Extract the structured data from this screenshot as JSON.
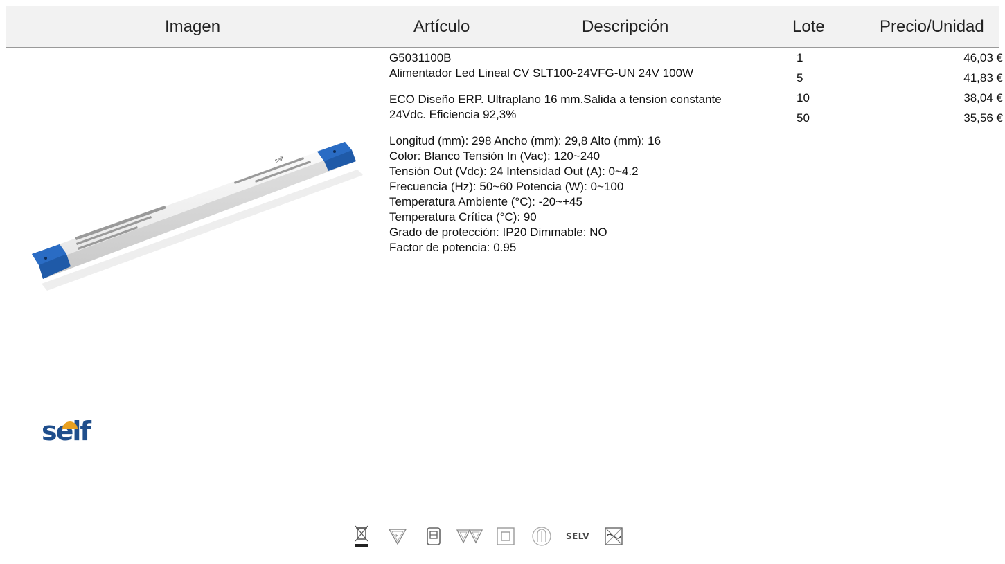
{
  "table_header": {
    "imagen": "Imagen",
    "articulo": "Artículo",
    "descripcion": "Descripción",
    "lote": "Lote",
    "precio_unidad": "Precio/Unidad"
  },
  "product": {
    "code": "G5031100B",
    "name": "Alimentador Led Lineal  CV SLT100-24VFG-UN 24V 100W",
    "summary": "ECO Diseño ERP. Ultraplano 16 mm.Salida a tension constante 24Vdc. Eficiencia 92,3%",
    "specs": [
      "Longitud (mm): 298 Ancho (mm): 29,8 Alto (mm): 16",
      "Color: Blanco Tensión In (Vac): 120~240",
      "Tensión Out (Vdc): 24 Intensidad Out (A): 0~4.2",
      "Frecuencia (Hz): 50~60 Potencia (W): 0~100",
      "Temperatura Ambiente (°C): -20~+45",
      "Temperatura Crítica (°C): 90",
      "Grado de protección: IP20 Dimmable: NO",
      "Factor de potencia: 0.95"
    ],
    "product_label_text": "self"
  },
  "brand": {
    "logo_text": "self",
    "accent_color": "#e8a020",
    "logo_color": "#1f4e8c"
  },
  "prices": [
    {
      "lote": "1",
      "precio": "46,03 €"
    },
    {
      "lote": "5",
      "precio": "41,83 €"
    },
    {
      "lote": "10",
      "precio": "38,04 €"
    },
    {
      "lote": "50",
      "precio": "35,56 €"
    }
  ],
  "certifications": [
    {
      "icon": "weee-bin-icon"
    },
    {
      "icon": "f-marking-icon"
    },
    {
      "icon": "independent-driver-icon"
    },
    {
      "icon": "ff-marking-icon"
    },
    {
      "icon": "class-ii-icon"
    },
    {
      "icon": "thermal-protection-icon"
    },
    {
      "icon": "selv-icon",
      "label": "SELV"
    },
    {
      "icon": "short-circuit-protection-icon"
    }
  ],
  "colors": {
    "header_bg": "#f2f2f2",
    "driver_end_cap": "#1f5aa8"
  }
}
